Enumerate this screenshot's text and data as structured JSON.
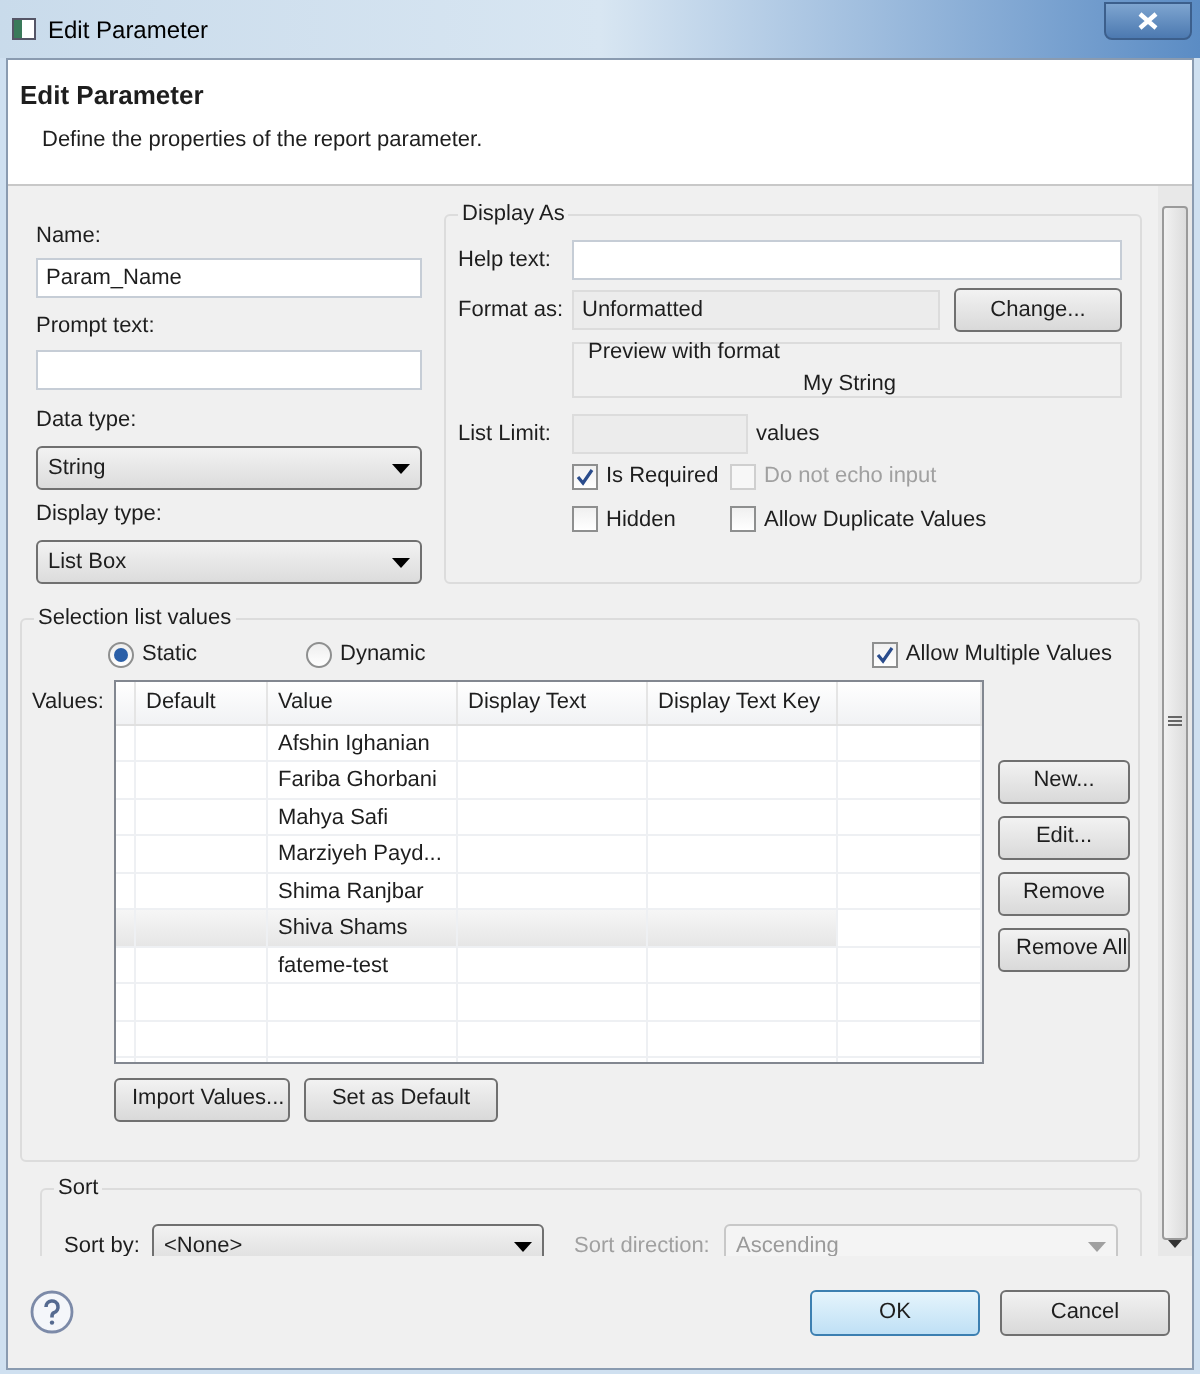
{
  "window": {
    "title": "Edit Parameter"
  },
  "header": {
    "title": "Edit Parameter",
    "description": "Define the properties of the report parameter."
  },
  "general": {
    "name": {
      "label": "Name:",
      "value": "Param_Name"
    },
    "prompt_text": {
      "label": "Prompt text:"
    },
    "data_type": {
      "label": "Data type:",
      "value": "String"
    },
    "display_type": {
      "label": "Display type:",
      "value": "List Box"
    }
  },
  "display_as": {
    "title": "Display As",
    "help_text": {
      "label": "Help text:"
    },
    "format_as": {
      "label": "Format as:",
      "value": "Unformatted",
      "button": "Change..."
    },
    "preview": {
      "title": "Preview with format",
      "value": "My String"
    },
    "list_limit": {
      "label": "List Limit:",
      "suffix": "values"
    },
    "checkboxes": [
      {
        "label": "Is Required",
        "checked": true,
        "disabled": false
      },
      {
        "label": "Do not echo input",
        "checked": false,
        "disabled": true
      },
      {
        "label": "Hidden",
        "checked": false,
        "disabled": false
      },
      {
        "label": "Allow Duplicate Values",
        "checked": false,
        "disabled": false
      }
    ]
  },
  "selection": {
    "title": "Selection list values",
    "radios": [
      {
        "label": "Static",
        "selected": true
      },
      {
        "label": "Dynamic",
        "selected": false
      }
    ],
    "allow_multiple": {
      "label": "Allow Multiple Values",
      "checked": true
    },
    "values_label": "Values:",
    "columns": [
      "Default",
      "Value",
      "Display Text",
      "Display Text Key"
    ],
    "rows": [
      {
        "value": "Afshin Ighanian",
        "selected": false
      },
      {
        "value": "Fariba Ghorbani",
        "selected": false
      },
      {
        "value": "Mahya Safi",
        "selected": false
      },
      {
        "value": "Marziyeh Payd...",
        "selected": false
      },
      {
        "value": "Shima Ranjbar",
        "selected": false
      },
      {
        "value": "Shiva Shams",
        "selected": true
      },
      {
        "value": "fateme-test",
        "selected": false
      }
    ],
    "side_buttons": [
      "New...",
      "Edit...",
      "Remove",
      "Remove All"
    ],
    "bottom_buttons": [
      "Import Values...",
      "Set as Default"
    ]
  },
  "sort": {
    "title": "Sort",
    "sort_by": {
      "label": "Sort by:",
      "value": "<None>"
    },
    "sort_direction": {
      "label": "Sort direction:",
      "value": "Ascending",
      "disabled": true
    }
  },
  "footer": {
    "buttons": [
      {
        "label": "OK",
        "default": true
      },
      {
        "label": "Cancel",
        "default": false
      }
    ]
  }
}
